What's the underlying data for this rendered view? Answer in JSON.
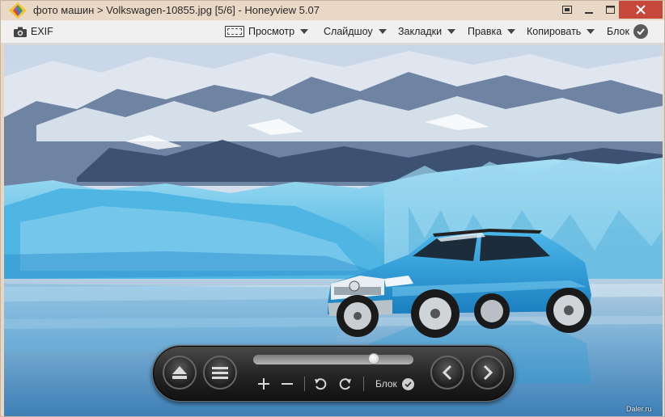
{
  "window": {
    "title": "фото машин > Volkswagen-10855.jpg [5/6] - Honeyview 5.07"
  },
  "toolbar": {
    "exif_label": "EXIF",
    "view_label": "Просмотр",
    "slideshow_label": "Слайдшоу",
    "bookmarks_label": "Закладки",
    "edit_label": "Правка",
    "copy_label": "Копировать",
    "lock_label": "Блок"
  },
  "panel": {
    "lock_label": "Блок",
    "zoom_slider_position": 0.77
  },
  "watermark": "Daler.ru",
  "colors": {
    "titlebar": "#ead8c7",
    "close_button": "#c7473a",
    "toolbar": "#f0f0f0",
    "car_body": "#2a9fd8",
    "ice": "#7fd0ee"
  },
  "icons": {
    "exif": "camera-icon",
    "view": "frame-icon",
    "lock": "check-circle-icon",
    "eject": "eject-icon",
    "menu": "hamburger-menu-icon",
    "zoom_in": "plus-icon",
    "zoom_out": "minus-icon",
    "rotate_left": "rotate-left-icon",
    "rotate_right": "rotate-right-icon",
    "prev": "chevron-left-icon",
    "next": "chevron-right-icon"
  }
}
